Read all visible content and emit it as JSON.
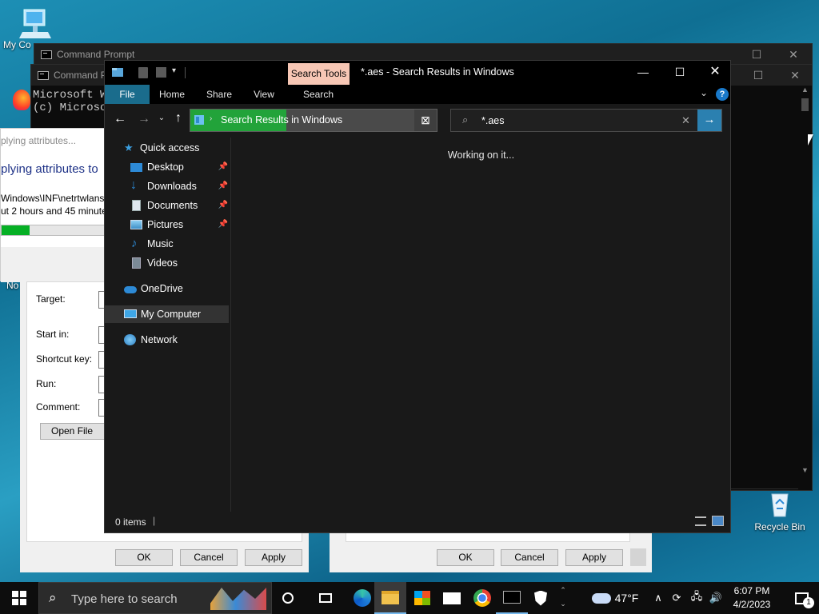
{
  "desktop": {
    "icons": {
      "my_computer": "My Co",
      "no": "No",
      "recycle_bin": "Recycle Bin"
    }
  },
  "cmd_back": {
    "title": "Command Prompt"
  },
  "cmd_front": {
    "title": "Command P",
    "lines": [
      "Microsoft W",
      "(c) Microso"
    ]
  },
  "progress_dialog": {
    "title": "plying attributes...",
    "heading": "plying attributes to",
    "path": "Windows\\INF\\netrtwlans.",
    "time": "ut 2 hours and 45 minute",
    "progress": 0.27
  },
  "props_left": {
    "labels": {
      "target": "Target:",
      "start_in": "Start in:",
      "shortcut_key": "Shortcut key:",
      "run": "Run:",
      "comment": "Comment:"
    },
    "open_file_loc": "Open File Loc",
    "ok": "OK",
    "cancel": "Cancel",
    "apply": "Apply"
  },
  "props_right": {
    "ok": "OK",
    "cancel": "Cancel",
    "apply": "Apply"
  },
  "explorer": {
    "contextual_tab": "Search Tools",
    "title": "*.aes - Search Results in Windows",
    "tabs": {
      "file": "File",
      "home": "Home",
      "share": "Share",
      "view": "View",
      "search": "Search"
    },
    "address": "Search Results in Windows",
    "search_value": "*.aes",
    "working": "Working on it...",
    "nav": {
      "quick_access": "Quick access",
      "desktop": "Desktop",
      "downloads": "Downloads",
      "documents": "Documents",
      "pictures": "Pictures",
      "music": "Music",
      "videos": "Videos",
      "onedrive": "OneDrive",
      "my_computer": "My Computer",
      "network": "Network"
    },
    "status_items": "0 items",
    "colors": {
      "file_tab": "#1a6c8c",
      "contextual_tab": "#f7c7b5",
      "address_progress": "#22a33a"
    }
  },
  "taskbar": {
    "search_placeholder": "Type here to search",
    "weather": "47°F",
    "time": "6:07 PM",
    "date": "4/2/2023",
    "notifications": "1"
  }
}
